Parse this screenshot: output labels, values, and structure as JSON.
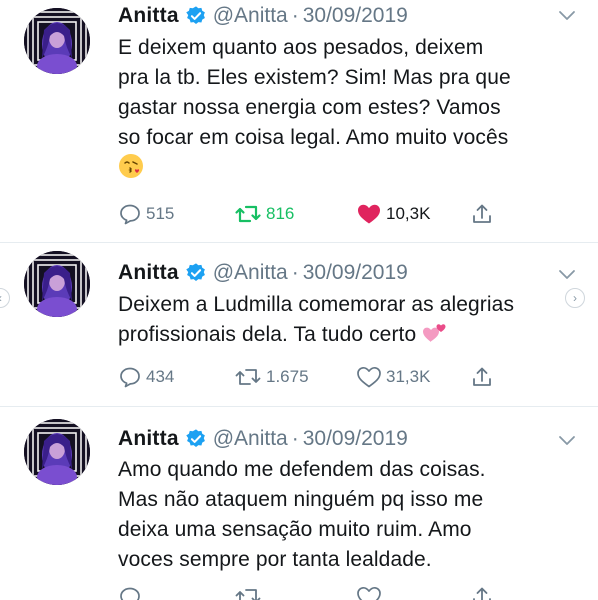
{
  "tweets": [
    {
      "display_name": "Anitta",
      "handle": "@Anitta",
      "separator": "·",
      "date": "30/09/2019",
      "text_lines": [
        "E deixem quanto aos pesados, deixem",
        "pra la tb. Eles existem? Sim! Mas pra que",
        "gastar nossa energia com estes? Vamos",
        "so focar em coisa legal. Amo muito vocês"
      ],
      "emoji": "kissing-face-with-heart-emoji",
      "replies": "515",
      "retweets": "816",
      "likes": "10,3K",
      "retweeted": true,
      "liked": true
    },
    {
      "display_name": "Anitta",
      "handle": "@Anitta",
      "separator": "·",
      "date": "30/09/2019",
      "text_lines": [
        "Deixem a Ludmilla comemorar as alegrias",
        "profissionais dela. Ta tudo certo"
      ],
      "emoji": "two-hearts-emoji",
      "replies": "434",
      "retweets": "1.675",
      "likes": "31,3K",
      "retweeted": false,
      "liked": false
    },
    {
      "display_name": "Anitta",
      "handle": "@Anitta",
      "separator": "·",
      "date": "30/09/2019",
      "text_lines": [
        "Amo quando me defendem das coisas.",
        "Mas não ataquem ninguém pq isso me",
        "deixa uma sensação muito ruim. Amo",
        "voces sempre por tanta lealdade."
      ],
      "emoji": "",
      "replies": "",
      "retweets": "",
      "likes": "",
      "retweeted": false,
      "liked": false
    }
  ],
  "icons": {
    "verified": "verified-badge-icon",
    "reply": "reply-icon",
    "retweet": "retweet-icon",
    "like": "heart-icon",
    "share": "share-icon",
    "menu": "chevron-down-icon",
    "carousel_prev": "chevron-left-icon",
    "carousel_next": "chevron-right-icon"
  },
  "colors": {
    "text": "#14171a",
    "muted": "#657786",
    "verified": "#1da1f2",
    "retweet_active": "#17bf63",
    "like_active": "#e0245e",
    "divider": "#e6ecf0"
  }
}
